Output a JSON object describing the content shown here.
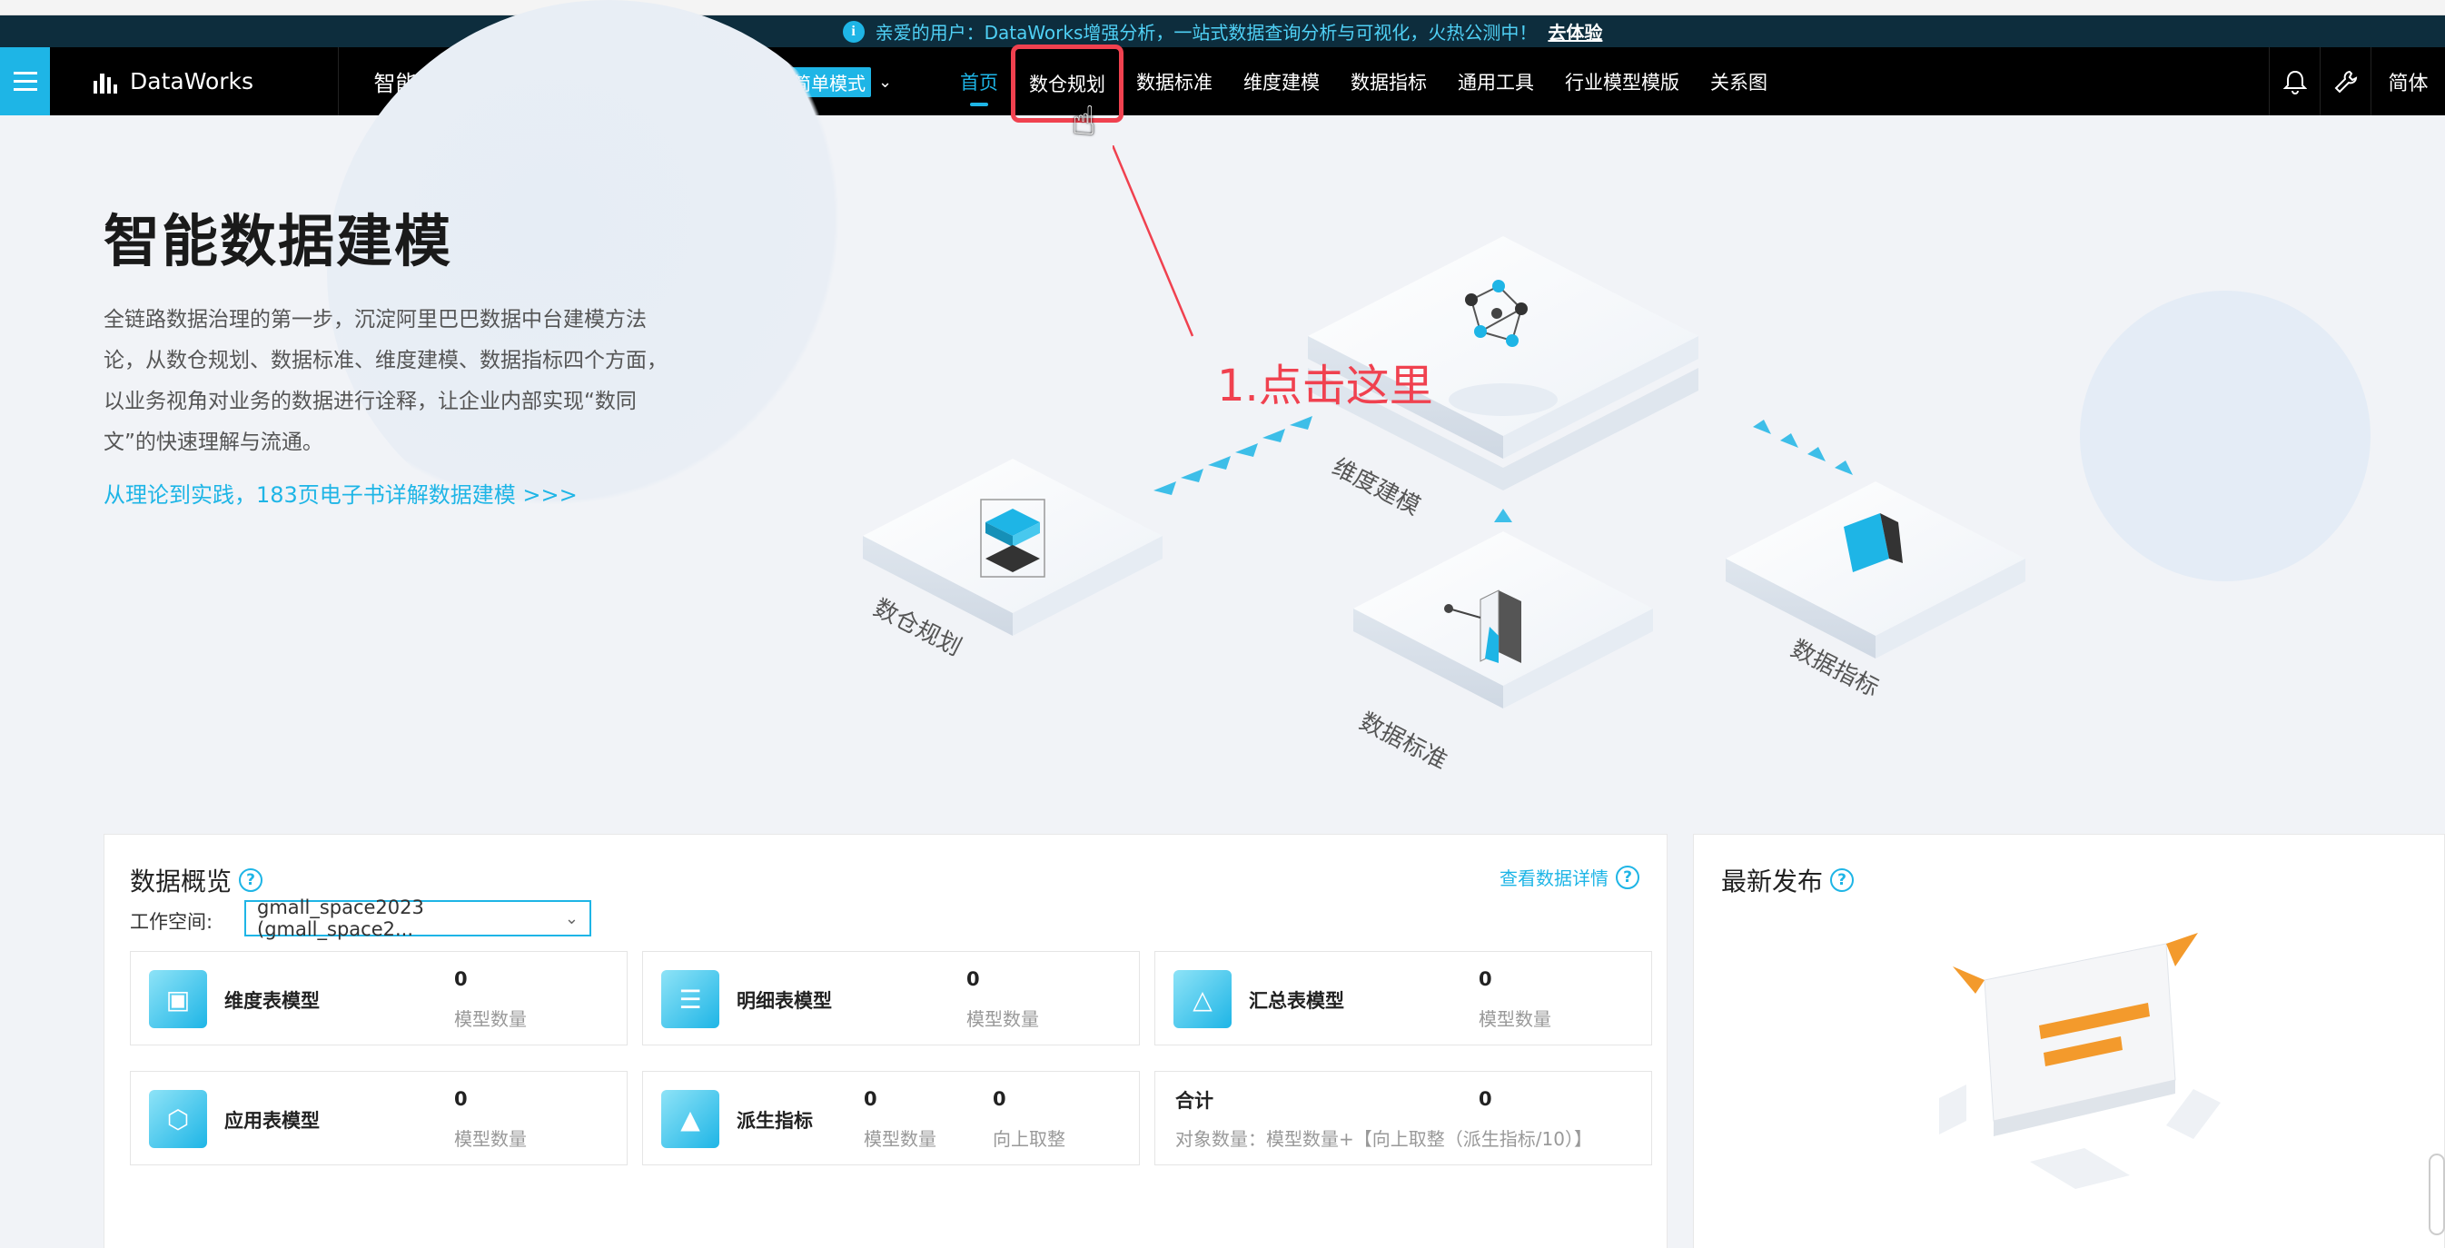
{
  "announcement": {
    "text": "亲爱的用户：DataWorks增强分析，一站式数据查询分析与可视化，火热公测中！",
    "link": "去体验"
  },
  "nav": {
    "brand": "DataWorks",
    "product": "智能数据建模",
    "workspace_name": "gmall_space2023",
    "workspace_sub": "gmall_space2023",
    "mode": "简单模式",
    "tabs": [
      {
        "label": "首页"
      },
      {
        "label": "数仓规划"
      },
      {
        "label": "数据标准"
      },
      {
        "label": "维度建模"
      },
      {
        "label": "数据指标"
      },
      {
        "label": "通用工具"
      },
      {
        "label": "行业模型模版"
      },
      {
        "label": "关系图"
      }
    ],
    "lang": "简体",
    "icons": [
      "bell-icon",
      "wrench-icon"
    ]
  },
  "hero": {
    "title": "智能数据建模",
    "description": "全链路数据治理的第一步，沉淀阿里巴巴数据中台建模方法论，从数仓规划、数据标准、维度建模、数据指标四个方面，以业务视角对业务的数据进行诠释，让企业内部实现“数同文”的快速理解与流通。",
    "link": "从理论到实践，183页电子书详解数据建模 >>>",
    "illustration_labels": {
      "warehouse": "数仓规划",
      "dimension": "维度建模",
      "standard": "数据标准",
      "metric": "数据指标"
    },
    "annotation": "1.点击这里"
  },
  "overview": {
    "title": "数据概览",
    "detail_link": "查看数据详情",
    "workspace_label": "工作空间:",
    "workspace_value": "gmall_space2023 (gmall_space2...",
    "cards": [
      {
        "name": "维度表模型",
        "value": "0",
        "sub": "模型数量"
      },
      {
        "name": "明细表模型",
        "value": "0",
        "sub": "模型数量"
      },
      {
        "name": "汇总表模型",
        "value": "0",
        "sub": "模型数量"
      },
      {
        "name": "应用表模型",
        "value": "0",
        "sub": "模型数量"
      },
      {
        "name": "派生指标",
        "value": "0",
        "sub": "模型数量",
        "value2": "0",
        "sub2": "向上取整"
      }
    ],
    "total": {
      "label": "合计",
      "value": "0",
      "formula": "对象数量：模型数量+【向上取整（派生指标/10）】"
    }
  },
  "latest": {
    "title": "最新发布"
  },
  "colors": {
    "accent": "#1eb5e6",
    "annotation": "#f0414f",
    "nav_bg": "#000000",
    "announce_bg": "#0d2d3d"
  }
}
